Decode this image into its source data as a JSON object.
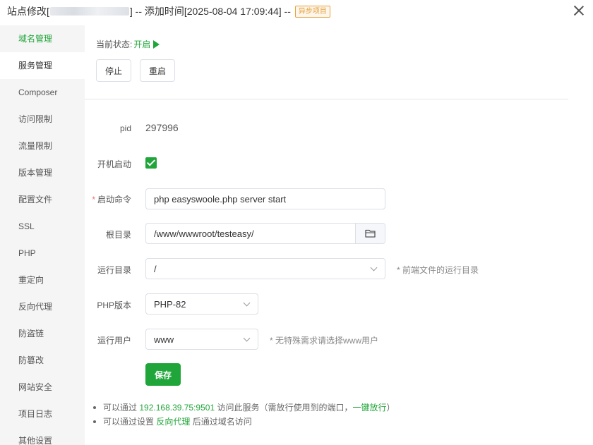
{
  "titlebar": {
    "prefix": "站点修改[",
    "suffix": "] -- 添加时间[2025-08-04 17:09:44] --",
    "tag": "异步项目"
  },
  "sidebar": {
    "items": [
      {
        "label": "域名管理"
      },
      {
        "label": "服务管理"
      },
      {
        "label": "Composer"
      },
      {
        "label": "访问限制"
      },
      {
        "label": "流量限制"
      },
      {
        "label": "版本管理"
      },
      {
        "label": "配置文件"
      },
      {
        "label": "SSL"
      },
      {
        "label": "PHP"
      },
      {
        "label": "重定向"
      },
      {
        "label": "反向代理"
      },
      {
        "label": "防盗链"
      },
      {
        "label": "防篡改"
      },
      {
        "label": "网站安全"
      },
      {
        "label": "项目日志"
      },
      {
        "label": "其他设置"
      }
    ]
  },
  "status": {
    "label": "当前状态:",
    "value": "开启",
    "stop_label": "停止",
    "restart_label": "重启"
  },
  "form": {
    "pid_label": "pid",
    "pid_value": "297996",
    "autostart_label": "开机启动",
    "autostart_checked": true,
    "start_cmd_label": "启动命令",
    "start_cmd_required": "*",
    "start_cmd_value": "php easyswoole.php server start",
    "root_label": "根目录",
    "root_value": "/www/wwwroot/testeasy/",
    "run_dir_label": "运行目录",
    "run_dir_value": "/",
    "run_dir_hint": "* 前端文件的运行目录",
    "php_version_label": "PHP版本",
    "php_version_value": "PHP-82",
    "run_user_label": "运行用户",
    "run_user_value": "www",
    "run_user_hint": "* 无特殊需求请选择www用户",
    "save_label": "保存"
  },
  "notes": {
    "n1_a": "可以通过",
    "n1_ip": "192.168.39.75:9501",
    "n1_b": "访问此服务（需放行使用到的端口，",
    "n1_link": "一键放行",
    "n1_c": "）",
    "n2_a": "可以通过设置",
    "n2_link": "反向代理",
    "n2_b": "后通过域名访问"
  },
  "colors": {
    "accent": "#20a53a",
    "tag": "#e6a23c",
    "required": "#f56c6c"
  }
}
